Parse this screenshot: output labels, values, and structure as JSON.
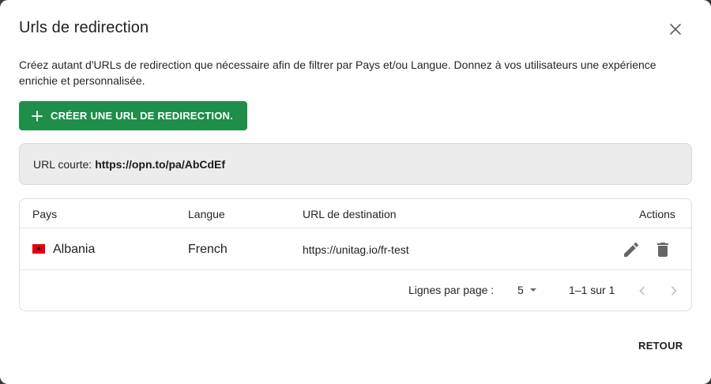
{
  "dialog": {
    "title": "Urls de redirection",
    "description": "Créez autant d'URLs de redirection que nécessaire afin de filtrer par Pays et/ou Langue. Donnez à vos utilisateurs une expérience enrichie et personnalisée.",
    "create_button_label": "CRÉER UNE URL DE REDIRECTION.",
    "short_url_label": "URL courte:",
    "short_url_value": "https://opn.to/pa/AbCdEf",
    "back_button_label": "RETOUR"
  },
  "table": {
    "headers": {
      "country": "Pays",
      "language": "Langue",
      "destination": "URL de destination",
      "actions": "Actions"
    },
    "rows": [
      {
        "country": "Albania",
        "language": "French",
        "url": "https://unitag.io/fr-test"
      }
    ]
  },
  "pagination": {
    "rows_per_page_label": "Lignes par page :",
    "rows_per_page_value": "5",
    "range_text": "1–1 sur 1"
  },
  "colors": {
    "accent_green": "#1e8e4a",
    "albania_flag_red": "#e3000f"
  },
  "icons": [
    "close-icon",
    "plus-icon",
    "albania-flag-icon",
    "edit-pencil-icon",
    "trash-icon",
    "chevron-down-icon",
    "chevron-left-icon",
    "chevron-right-icon"
  ]
}
